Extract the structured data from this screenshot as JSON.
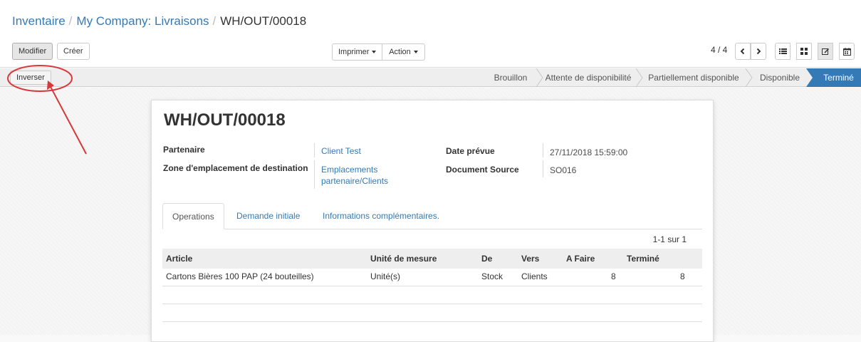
{
  "breadcrumb": {
    "items": [
      "Inventaire",
      "My Company: Livraisons"
    ],
    "current": "WH/OUT/00018"
  },
  "toolbar": {
    "edit_label": "Modifier",
    "create_label": "Créer",
    "print_label": "Imprimer",
    "action_label": "Action"
  },
  "pager": {
    "value": "4 / 4"
  },
  "views": [
    "list-icon",
    "kanban-icon",
    "form-icon",
    "calendar-icon"
  ],
  "status": {
    "reverse_label": "Inverser",
    "stages": [
      "Brouillon",
      "Attente de disponibilité",
      "Partiellement disponible",
      "Disponible",
      "Terminé"
    ],
    "current": "Terminé",
    "accent": "#337ab7"
  },
  "record": {
    "name": "WH/OUT/00018",
    "partner_label": "Partenaire",
    "partner_value": "Client Test",
    "dest_label": "Zone d'emplacement de destination",
    "dest_value_line1": "Emplacements",
    "dest_value_line2": "partenaire/Clients",
    "date_label": "Date prévue",
    "date_value": "27/11/2018 15:59:00",
    "source_label": "Document Source",
    "source_value": "SO016"
  },
  "tabs": [
    "Operations",
    "Demande initiale",
    "Informations complémentaires."
  ],
  "table": {
    "pager": "1-1 sur 1",
    "headers": [
      "Article",
      "Unité de mesure",
      "De",
      "Vers",
      "A Faire",
      "Terminé"
    ],
    "rows": [
      [
        "Cartons Bières 100 PAP (24 bouteilles)",
        "Unité(s)",
        "Stock",
        "Clients",
        "8",
        "8"
      ]
    ]
  },
  "annotation_color": "#d9383a"
}
